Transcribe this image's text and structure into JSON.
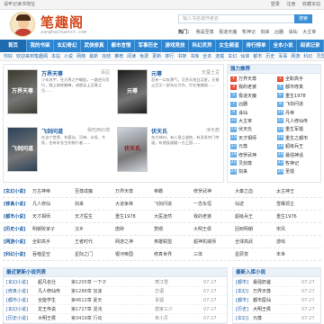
{
  "topbar": {
    "left": "请牢记读书地址",
    "right": [
      "登录",
      "注册",
      "收藏本站"
    ]
  },
  "site": {
    "title": "笔趣阁",
    "subtitle": "zanghaihuatxt.com"
  },
  "search": {
    "placeholder": "输入书名或作者名",
    "button": "搜索"
  },
  "hot": {
    "label": "热门：",
    "items": [
      "我是至尊",
      "极道天魔",
      "牧神记",
      "剑来",
      "凶器",
      "诛仙",
      "大主宰"
    ]
  },
  "nav": [
    "首页",
    "我的书架",
    "玄幻奇幻",
    "武侠修真",
    "都市言情",
    "军事历史",
    "游戏竞技",
    "科幻灵异",
    "女生频道",
    "排行榜单",
    "全本小说",
    "阅读记录"
  ],
  "subbar": [
    "你好",
    "欢迎来到笔趣阁",
    "本站",
    "小说",
    "网络",
    "最新",
    "完结",
    "推荐",
    "阅读",
    "免费",
    "更新",
    "排行",
    "书架",
    "书库",
    "全本",
    "连载",
    "玄幻",
    "仙侠",
    "都市",
    "历史",
    "军事",
    "网游",
    "科幻",
    "灵异"
  ],
  "featured": [
    {
      "title": "万界天尊",
      "author": "百忍",
      "desc": "少年苏宇，在万界之中崛起，一路逆天而行，踏上修炼巅峰，成就无上至尊之位……",
      "cover": "万界天尊",
      "color": "#3b3a2e"
    },
    {
      "title": "元尊",
      "author": "天蚕土豆",
      "desc": "吾有一口玄黄气，可吞天地日月星。天蚕土豆又一部玄幻力作，尽在笔趣阁……",
      "cover": "元尊",
      "color": "#1c1c1c"
    },
    {
      "title": "飞剑问道",
      "author": "我吃西红柿",
      "desc": "在这个世界，有狐仙、河神、水怪、大妖，也有求长生的修行者……",
      "cover": "飞剑问道",
      "color": "#2a4258"
    },
    {
      "title": "伏天氏",
      "author": "净无痕",
      "desc": "东方神州，有人皇立道统，有圣贤宗门传道，有诸侯雄踞一方王国……",
      "cover": "伏天氏",
      "color": "#cfd6df"
    }
  ],
  "rank": {
    "title": "强力推荐",
    "rows": [
      [
        "万界天尊",
        "全职高手"
      ],
      [
        "我的老婆",
        "都市修真"
      ],
      [
        "极道天魔",
        "重生1978"
      ],
      [
        "凶器",
        "飞剑问道"
      ],
      [
        "诛仙",
        "丹帝"
      ],
      [
        "大主宰",
        "凡人修仙传"
      ],
      [
        "伏天氏",
        "重生军婚"
      ],
      [
        "天才相师",
        "重生之都市"
      ],
      [
        "元尊",
        "超级兵王"
      ],
      [
        "修罗武神",
        "最强神话"
      ],
      [
        "灵剑尊",
        "牧神记"
      ],
      [
        "剑来",
        "圣墟"
      ]
    ]
  },
  "categories": [
    {
      "label": "[玄幻小说]",
      "items": [
        "万古神帝",
        "至尊成魔",
        "万界天尊",
        "帝霸",
        "修罗武神",
        "大秦之血",
        "太古神王"
      ]
    },
    {
      "label": "[修真小说]",
      "items": [
        "凡人修仙",
        "剑来",
        "大道争锋",
        "飞剑问道",
        "一念永恒",
        "仙逆",
        "雪鹰领主"
      ]
    },
    {
      "label": "[都市小说]",
      "items": [
        "天才相师",
        "天才医生",
        "重生1978",
        "大医凌然",
        "我的老婆",
        "超级兵王",
        "重生1976"
      ]
    },
    {
      "label": "[历史小说]",
      "items": [
        "明朝败家子",
        "汉乡",
        "唐砖",
        "赘婿",
        "大明王侯",
        "回到明朝",
        "宋风"
      ]
    },
    {
      "label": "[网游小说]",
      "items": [
        "全职高手",
        "王者时代",
        "网游之神",
        "英雄联盟",
        "超神机械师",
        "全球高武",
        "游戏"
      ]
    },
    {
      "label": "[科幻小说]",
      "items": [
        "吞噬星空",
        "星际之门",
        "银河帝国",
        "修真世界",
        "三体",
        "星辰变",
        "末世"
      ]
    }
  ],
  "updates": {
    "title": "最近更新小说列表",
    "rows": [
      [
        "[玄幻小说]",
        "超凡名仕",
        "第1205章 一下子",
        "寒江雪",
        "07-27"
      ],
      [
        "[修真小说]",
        "凡人修仙传",
        "第1288章 加速",
        "忘语",
        "07-27"
      ],
      [
        "[都市小说]",
        "全能学生",
        "第4612章 夏天",
        "青狐",
        "07-27"
      ],
      [
        "[玄幻小说]",
        "龙王传说",
        "第1727章 混沌",
        "唐家三少",
        "07-27"
      ],
      [
        "[历史小说]",
        "大明王侯",
        "第3419章 行动",
        "朱小贝",
        "07-27"
      ]
    ]
  },
  "latest": {
    "title": "最新入库小说",
    "rows": [
      [
        "[都市]",
        "最强奶爸",
        "07-27"
      ],
      [
        "[玄幻]",
        "万界天尊",
        "07-27"
      ],
      [
        "[都市]",
        "都市医仙",
        "07-27"
      ],
      [
        "[历史]",
        "大明王侯",
        "07-27"
      ],
      [
        "[玄幻]",
        "元尊",
        "07-27"
      ]
    ]
  },
  "colors": {
    "nav": "#2c85d1",
    "link": "#1f5fa5",
    "logo": "#d54a20"
  }
}
